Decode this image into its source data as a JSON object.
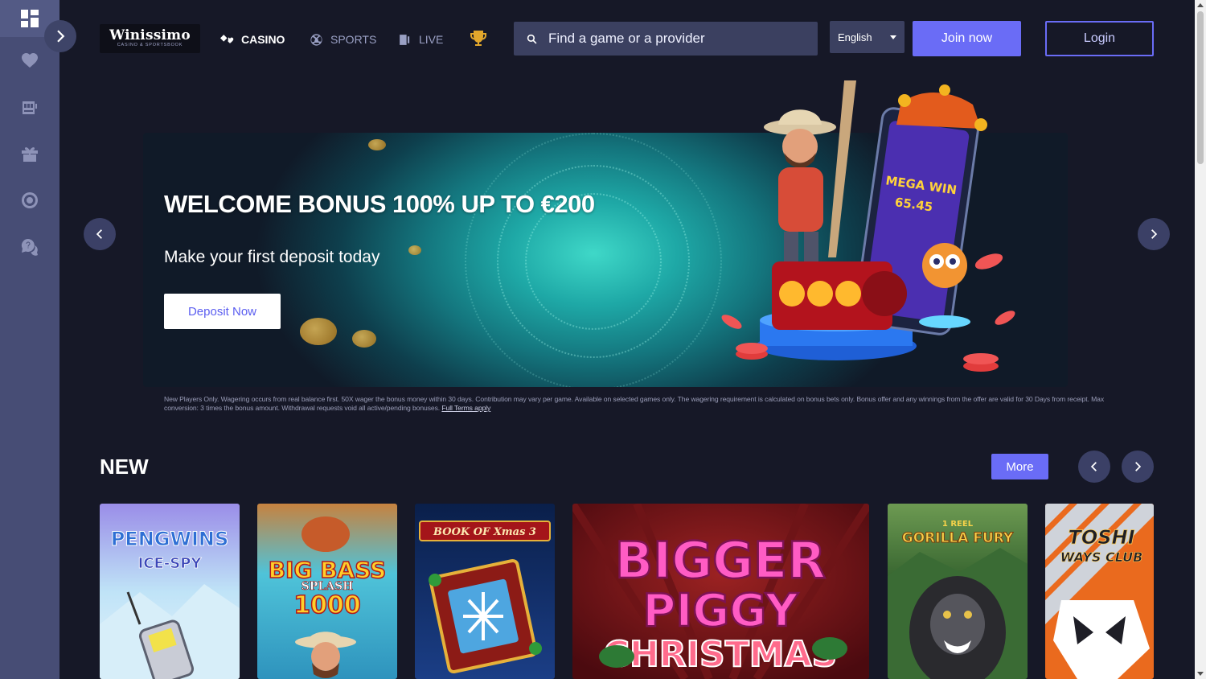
{
  "brand": {
    "logo_main": "Winissimo",
    "logo_sub": "CASINO & SPORTSBOOK"
  },
  "sidebar": {
    "items": [
      {
        "icon": "dashboard-icon"
      },
      {
        "icon": "heart-icon"
      },
      {
        "icon": "slot-machine-icon"
      },
      {
        "icon": "gift-icon"
      },
      {
        "icon": "chip-icon"
      },
      {
        "icon": "support-chat-icon"
      }
    ]
  },
  "nav": {
    "casino": "CASINO",
    "sports": "SPORTS",
    "live": "LIVE"
  },
  "search": {
    "placeholder": "Find a game or a provider"
  },
  "language": {
    "selected": "English"
  },
  "auth": {
    "join": "Join now",
    "login": "Login"
  },
  "hero": {
    "title": "WELCOME BONUS 100% UP TO €200",
    "subtitle": "Make your first deposit today",
    "cta": "Deposit Now",
    "terms": "New Players Only. Wagering occurs from real balance first. 50X wager the bonus money within 30 days. Contribution may vary per game. Available on selected games only. The wagering requirement is calculated on bonus bets only. Bonus offer and any winnings from the offer are valid for 30 Days from receipt. Max conversion: 3 times the bonus amount. Withdrawal requests void all active/pending bonuses.",
    "terms_link": "Full Terms apply"
  },
  "new_section": {
    "title": "NEW",
    "more": "More",
    "games": [
      {
        "line1": "PENGWINS",
        "line2": "ICE-SPY"
      },
      {
        "line1": "BIG BASS",
        "line2": "SPLASH",
        "line3": "1000"
      },
      {
        "line1": "BOOK OF Xmas 3"
      },
      {
        "line1": "BIGGER",
        "line2": "PIGGY",
        "line3": "CHRISTMAS"
      },
      {
        "line1": "1 REEL",
        "line2": "GORILLA FURY"
      },
      {
        "line1": "TOSHI",
        "line2": "WAYS CLUB"
      }
    ]
  },
  "colors": {
    "accent": "#6a6cf6",
    "background": "#161827",
    "sidebar": "#474d75"
  }
}
